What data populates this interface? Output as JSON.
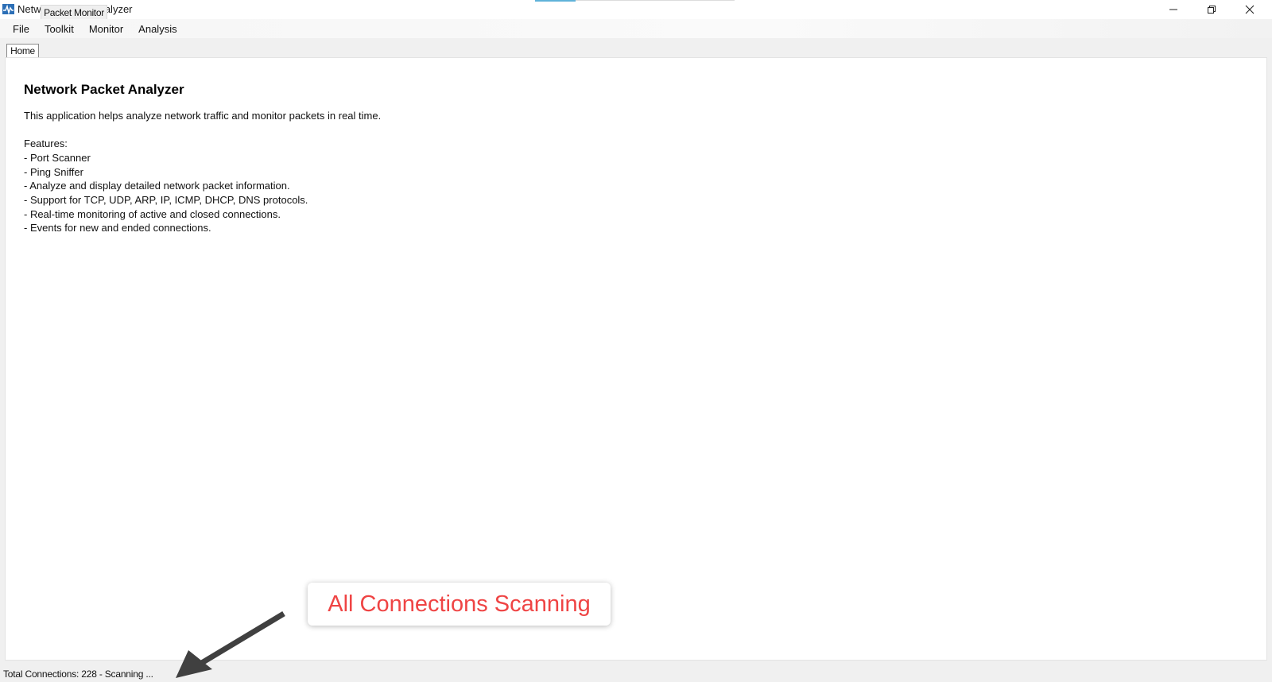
{
  "window": {
    "title": "Network Packet Analyzer",
    "controls": {
      "minimize_icon": "minimize-icon",
      "maximize_icon": "restore-icon",
      "close_icon": "close-icon"
    }
  },
  "menu": {
    "items": [
      {
        "label": "File"
      },
      {
        "label": "Toolkit"
      },
      {
        "label": "Monitor"
      },
      {
        "label": "Analysis"
      }
    ]
  },
  "tabs": [
    {
      "label": "Home",
      "selected": true
    },
    {
      "label": "Packet Monitor",
      "selected": false
    }
  ],
  "home": {
    "heading": "Network Packet Analyzer",
    "description": "This application helps analyze network traffic and monitor packets in real time.",
    "features_label": "Features:",
    "features": [
      "- Port Scanner",
      "- Ping Sniffer",
      "- Analyze and display detailed network packet information.",
      "- Support for TCP, UDP, ARP, IP, ICMP, DHCP, DNS protocols.",
      "- Real-time monitoring of active and closed connections.",
      "- Events for new and ended connections."
    ]
  },
  "status": {
    "text": "Total Connections: 228 - Scanning ..."
  },
  "annotation": {
    "callout_text": "All Connections Scanning",
    "callout_color": "#ef4444",
    "arrow_color": "#404040"
  }
}
